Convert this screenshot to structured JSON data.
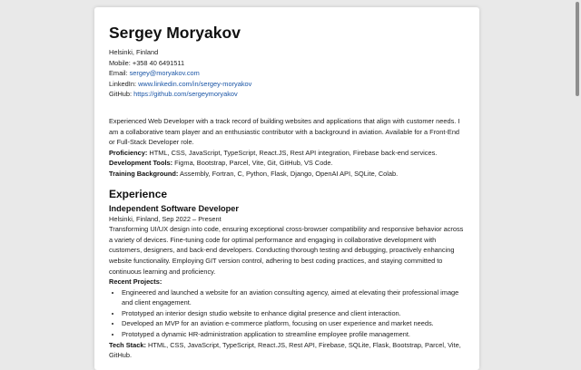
{
  "header": {
    "name": "Sergey Moryakov",
    "location": "Helsinki, Finland",
    "mobile": "Mobile: +358 40 6491511",
    "email_label": "Email: ",
    "email": "sergey@moryakov.com",
    "linkedin_label": "LinkedIn: ",
    "linkedin": "www.linkedin.com/in/sergey-moryakov",
    "github_label": "GitHub: ",
    "github": "https://github.com/sergeymoryakov"
  },
  "summary": {
    "text": "Experienced Web Developer with a track record of building websites and applications that align with customer needs. I am a collaborative team player and an enthusiastic contributor with a background in aviation. Available for a Front-End or Full-Stack Developer role.",
    "proficiency_label": "Proficiency:",
    "proficiency": " HTML, CSS, JavaScript, TypeScript, React.JS, Rest API integration, Firebase back-end services.",
    "tools_label": "Development Tools:",
    "tools": " Figma, Bootstrap, Parcel, Vite, Git, GitHub, VS Code.",
    "training_label": "Training Background:",
    "training": " Assembly, Fortran, C, Python, Flask, Django, OpenAI API, SQLite, Colab."
  },
  "experience": {
    "heading": "Experience",
    "job_title": "Independent Software Developer",
    "job_meta": "Helsinki, Finland, Sep 2022 – Present",
    "description": "Transforming UI/UX design into code, ensuring exceptional cross-browser compatibility and responsive behavior across a variety of devices. Fine-tuning code for optimal performance and engaging in collaborative development with customers, designers, and back-end developers. Conducting thorough testing and debugging, proactively enhancing website functionality. Employing GIT version control, adhering to best coding practices, and staying committed to continuous learning and proficiency.",
    "projects_label": "Recent Projects:",
    "projects": [
      "Engineered and launched a website for an aviation consulting agency, aimed at elevating their professional image and client engagement.",
      "Prototyped an interior design studio website to enhance digital presence and client interaction.",
      "Developed an MVP for an aviation e-commerce platform, focusing on user experience and market needs.",
      "Prototyped a dynamic HR-administration application to streamline employee profile management."
    ],
    "stack_label": "Tech Stack:",
    "stack": " HTML, CSS, JavaScript, TypeScript, React.JS, Rest API, Firebase, SQLite, Flask, Bootstrap, Parcel, Vite, GitHub."
  },
  "colors": {
    "background": "#e9e9e9",
    "page": "#ffffff",
    "link": "#1a55a6",
    "scrollbar": "#8e8e8e"
  }
}
